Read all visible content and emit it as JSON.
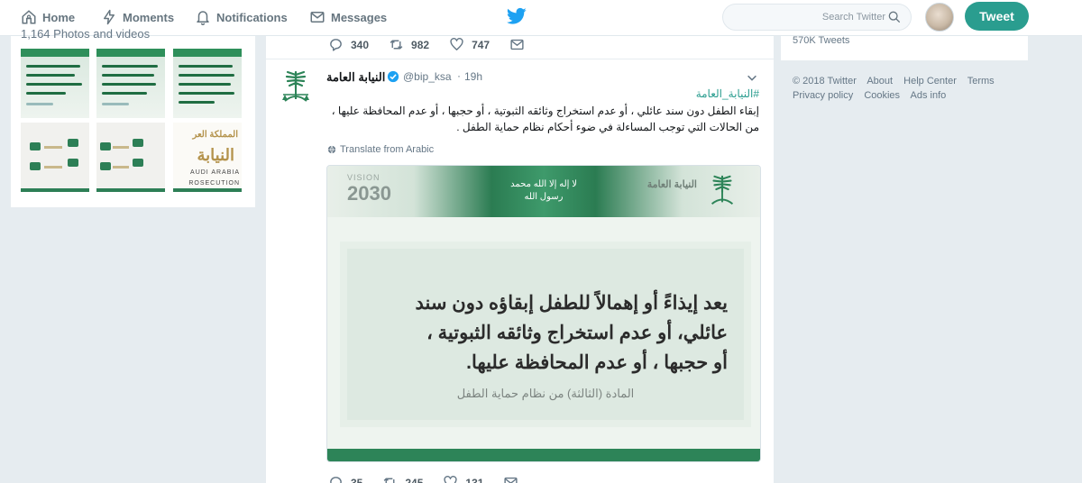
{
  "topbar": {
    "nav": [
      {
        "label": "Home",
        "icon": "home-icon"
      },
      {
        "label": "Moments",
        "icon": "lightning-icon"
      },
      {
        "label": "Notifications",
        "icon": "bell-icon"
      },
      {
        "label": "Messages",
        "icon": "envelope-icon"
      }
    ],
    "logo": "twitter-bird-icon",
    "search_placeholder": "Search Twitter",
    "tweet_button": "Tweet",
    "accent": "#2a9d8f"
  },
  "left": {
    "header": "1,164 Photos and videos"
  },
  "timeline": {
    "prev_tweet_actions": {
      "replies": "340",
      "retweets": "982",
      "likes": "747"
    },
    "tweet": {
      "name": "النيابة العامة",
      "handle": "@bip_ksa",
      "dot": "·",
      "time": "19h",
      "hashtag": "#النيابة_العامة",
      "text": "إبقاء الطفل دون سند عائلي ، أو عدم استخراج وثائقه الثبوتية ، أو حجبها ، أو عدم المحافظة عليها ، من الحالات التي توجب المساءلة في ضوء أحكام نظام حماية الطفل .",
      "translate": "Translate from Arabic",
      "media": {
        "vision_label": "VISION",
        "vision_year": "2030",
        "header_org": "النيابة العامة",
        "calligraphy": "لا إله إلا الله محمد رسول الله",
        "quote_lines": [
          "يعد إيذاءً أو إهمالاً للطفل إبقاؤه دون سند",
          "عائلي، أو عدم استخراج وثائقه الثبوتية ،",
          "أو حجبها ، أو عدم المحافظة عليها."
        ],
        "source": "المادة (الثالثة) من نظام حماية الطفل"
      },
      "actions": {
        "replies": "35",
        "retweets": "245",
        "likes": "131"
      }
    }
  },
  "right": {
    "tweets_count": "570K Tweets",
    "footer_links": [
      "© 2018 Twitter",
      "About",
      "Help Center",
      "Terms",
      "Privacy policy",
      "Cookies",
      "Ads info"
    ]
  }
}
